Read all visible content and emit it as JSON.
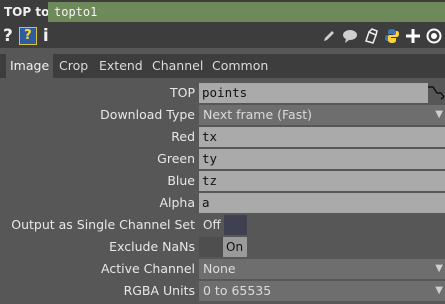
{
  "header": {
    "op_type": "TOP to",
    "op_name": "topto1"
  },
  "toolbar": {
    "left": [
      {
        "name": "help-icon",
        "glyph": "?"
      },
      {
        "name": "python-help-icon",
        "glyph": "?"
      },
      {
        "name": "info-icon",
        "glyph": "i"
      }
    ],
    "right_icons": [
      "edit-icon",
      "comment-icon",
      "clone-icon",
      "python-icon",
      "add-icon",
      "target-icon"
    ]
  },
  "tabs": [
    "Image",
    "Crop",
    "Extend",
    "Channel",
    "Common"
  ],
  "active_tab": "Image",
  "params": {
    "top": {
      "label": "TOP",
      "value": "points"
    },
    "download_type": {
      "label": "Download Type",
      "value": "Next frame (Fast)"
    },
    "red": {
      "label": "Red",
      "value": "tx"
    },
    "green": {
      "label": "Green",
      "value": "ty"
    },
    "blue": {
      "label": "Blue",
      "value": "tz"
    },
    "alpha": {
      "label": "Alpha",
      "value": "a"
    },
    "single_channel": {
      "label": "Output as Single Channel Set",
      "value": "Off"
    },
    "exclude_nans": {
      "label": "Exclude NaNs",
      "value": "On"
    },
    "active_channel": {
      "label": "Active Channel",
      "value": "None"
    },
    "rgba_units": {
      "label": "RGBA Units",
      "value": "0 to 65535"
    }
  },
  "colors": {
    "panel_bg": "#575757",
    "header_bg": "#3d3d3d",
    "name_field": "#6f8a5a",
    "text_field": "#aaaaaa",
    "menu_field": "#6e6e6e",
    "toggle_off_knob": "#3f4150"
  }
}
